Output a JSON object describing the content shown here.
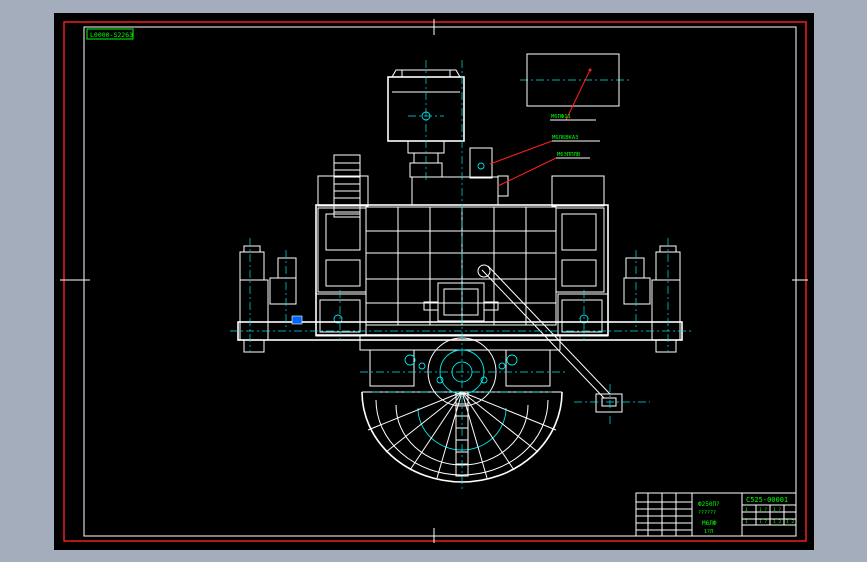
{
  "drawing": {
    "code_box": "L0000-S2263",
    "leader_labels": [
      "M6ПФ11",
      "M6Л6ВКАЗ",
      "M6ЭППЛВ"
    ],
    "title_block": {
      "drawing_no": "C525-00001",
      "material": "Ф250П?",
      "scale_line": "??????",
      "weight": "M6ЛФ",
      "sheet": "1?Л",
      "row_a": [
        "1",
        "1 ?",
        "1 ?"
      ],
      "row_b": [
        "1",
        "1 ?",
        "1 2",
        "1 2"
      ]
    },
    "colors": {
      "background": "#a3adbb",
      "sheet": "#000000",
      "frame": "#ff2020",
      "geometry": "#ffffff",
      "centerlines": "#00e5e5",
      "text": "#00ff00"
    }
  }
}
